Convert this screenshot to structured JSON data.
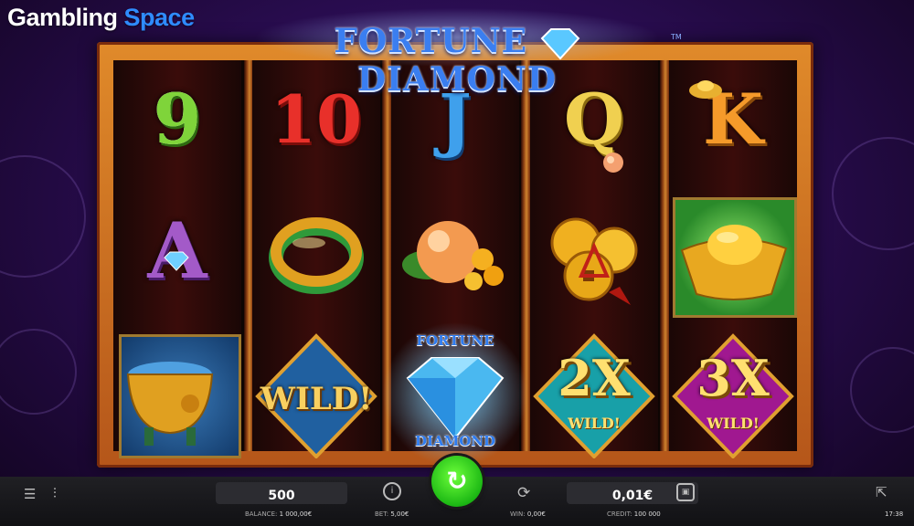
{
  "watermark": {
    "part1": "Gambling",
    "part2": "Space"
  },
  "game": {
    "title": "FORTUNE",
    "title2": "DIAMOND",
    "tm": "TM"
  },
  "reels": [
    [
      "9",
      "A",
      "pot"
    ],
    [
      "10",
      "jade-ring",
      "WILD!"
    ],
    [
      "J",
      "peach",
      "FORTUNE DIAMOND"
    ],
    [
      "Q",
      "coins",
      "2X WILD!"
    ],
    [
      "K",
      "gold-ingot",
      "3X WILD!"
    ]
  ],
  "symbols": {
    "r0": "9",
    "r1": "10",
    "r2": "J",
    "r3": "Q",
    "r4": "K",
    "a": "A",
    "wild": "WILD!",
    "fd_top": "FORTUNE",
    "fd_bottom": "DIAMOND",
    "x2": "2X",
    "x2_label": "WILD!",
    "x3": "3X",
    "x3_label": "WILD!"
  },
  "bottom_bar": {
    "bet_value": "500",
    "coin_value": "0,01€",
    "balance_label": "BALANCE:",
    "balance": "1 000,00€",
    "bet_label": "BET:",
    "bet": "5,00€",
    "win_label": "WIN:",
    "win": "0,00€",
    "credit_label": "CREDIT:",
    "credit": "100 000",
    "time": "17:38",
    "icons": [
      "menu-icon",
      "settings-sliders-icon",
      "info-icon",
      "spin-icon",
      "autoplay-icon",
      "turbo-icon",
      "exit-icon"
    ]
  },
  "colors": {
    "spin": "#28c81c",
    "frame": "#d07a28",
    "background": "#2a0d52"
  }
}
